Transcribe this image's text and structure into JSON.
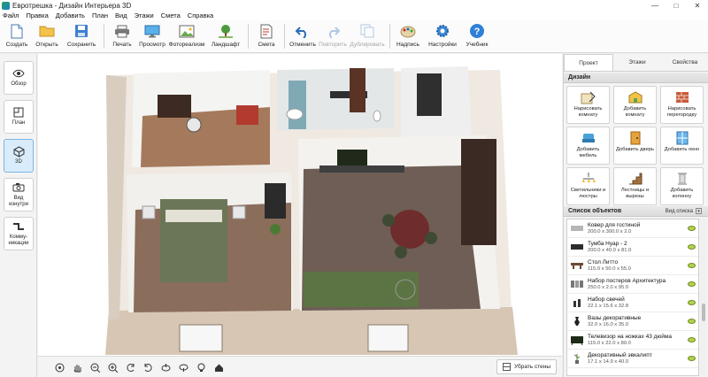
{
  "window": {
    "title": "Евротрешка - Дизайн Интерьера 3D"
  },
  "menu": [
    "Файл",
    "Правка",
    "Добавить",
    "План",
    "Вид",
    "Этажи",
    "Смета",
    "Справка"
  ],
  "toolbar": {
    "create": "Создать",
    "open": "Открыть",
    "save": "Сохранить",
    "print": "Печать",
    "preview": "Просмотр",
    "photorealism": "Фотореализм",
    "landscape": "Ландшафт",
    "estimate": "Смета",
    "undo": "Отменить",
    "redo": "Повторить",
    "duplicate": "Дублировать",
    "label": "Надпись",
    "settings": "Настройки",
    "tutorial": "Учебник"
  },
  "leftnav": {
    "overview": "Обзор",
    "plan": "План",
    "view3d": "3D",
    "inside": "Вид изнутри",
    "comms": "Комму-никации"
  },
  "viewbar": {
    "remove_walls": "Убрать стены"
  },
  "rightpanel": {
    "tabs": [
      "Проект",
      "Этажи",
      "Свойства"
    ],
    "design_title": "Дизайн",
    "design_buttons": [
      "Нарисовать комнату",
      "Добавить комнату",
      "Нарисовать перегородку",
      "Добавить мебель",
      "Добавить дверь",
      "Добавить окно",
      "Светильники и люстры",
      "Лестницы и вырезы",
      "Добавить колонну"
    ],
    "objlist_title": "Список объектов",
    "view_list": "Вид списка",
    "objects": [
      {
        "name": "Ковер для гостиной",
        "size": "200.0 x 300.0 x 2.0"
      },
      {
        "name": "Тумба Нуар - 2",
        "size": "200.0 x 40.0 x 81.0"
      },
      {
        "name": "Стол Литто",
        "size": "115.0 x 50.0 x 55.0"
      },
      {
        "name": "Набор постеров Архитектура",
        "size": "250.0 x 2.0 x 95.0"
      },
      {
        "name": "Набор свечей",
        "size": "22.1 x 15.6 x 32.8"
      },
      {
        "name": "Вазы декоративные",
        "size": "32.0 x 16.0 x 35.0"
      },
      {
        "name": "Телевизор на ножках 43 дюйма",
        "size": "115.0 x 22.0 x 80.0"
      },
      {
        "name": "Декоративный эвкалипт",
        "size": "17.1 x 14.9 x 40.0"
      }
    ]
  },
  "colors": {
    "accent": "#2b7fd4",
    "floor_wood": "#8a6a55",
    "wall_outer": "#d8c7b5",
    "bed_green": "#5f6d4f"
  }
}
